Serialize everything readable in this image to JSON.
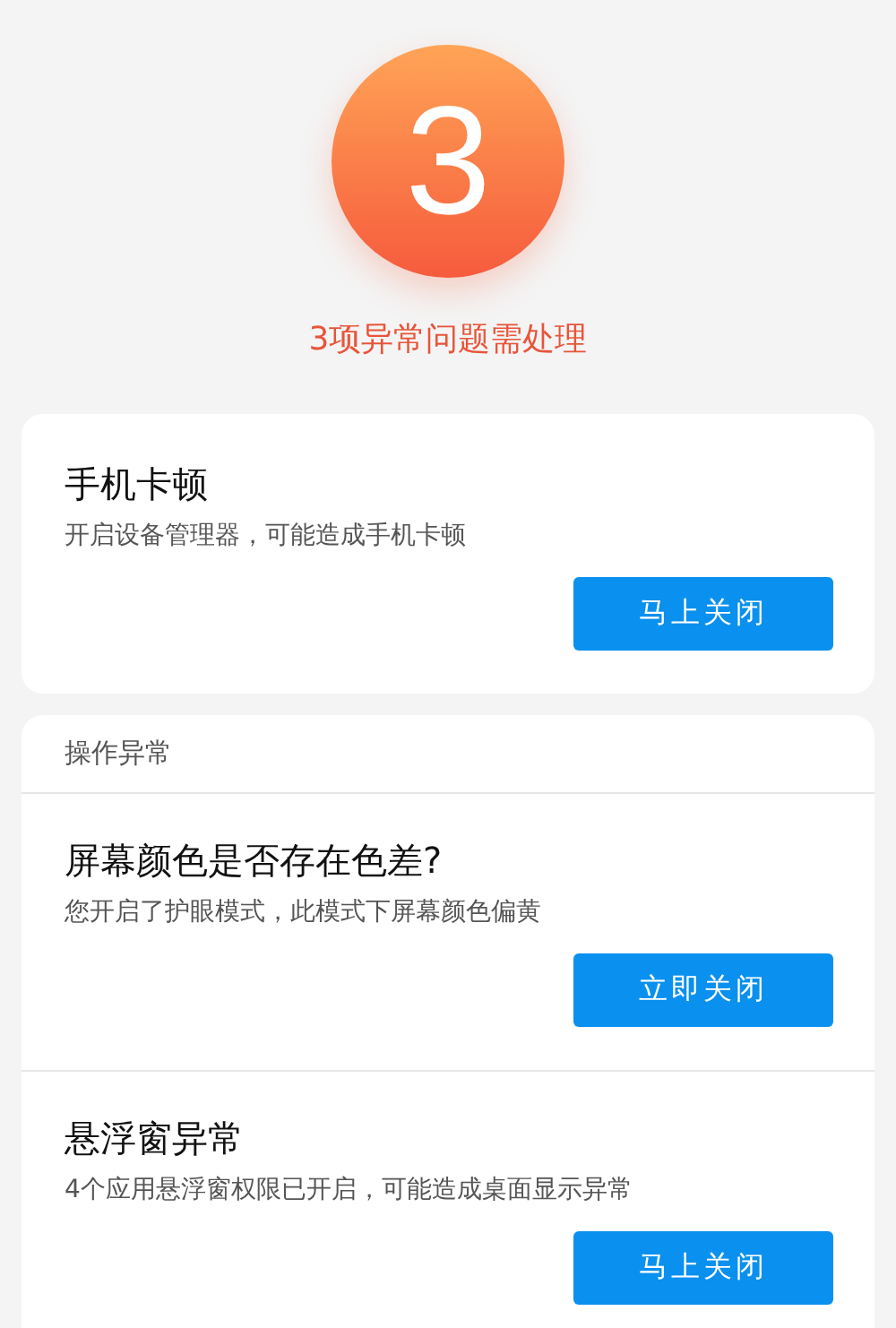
{
  "badge": {
    "count": "3",
    "message": "3项异常问题需处理"
  },
  "first_card": {
    "items": [
      {
        "title": "手机卡顿",
        "description": "开启设备管理器，可能造成手机卡顿",
        "button": "马上关闭"
      }
    ]
  },
  "section": {
    "title": "操作异常",
    "items": [
      {
        "title": "屏幕颜色是否存在色差?",
        "description": "您开启了护眼模式，此模式下屏幕颜色偏黄",
        "button": "立即关闭"
      },
      {
        "title": "悬浮窗异常",
        "description": "4个应用悬浮窗权限已开启，可能造成桌面显示异常",
        "button": "马上关闭"
      }
    ]
  }
}
